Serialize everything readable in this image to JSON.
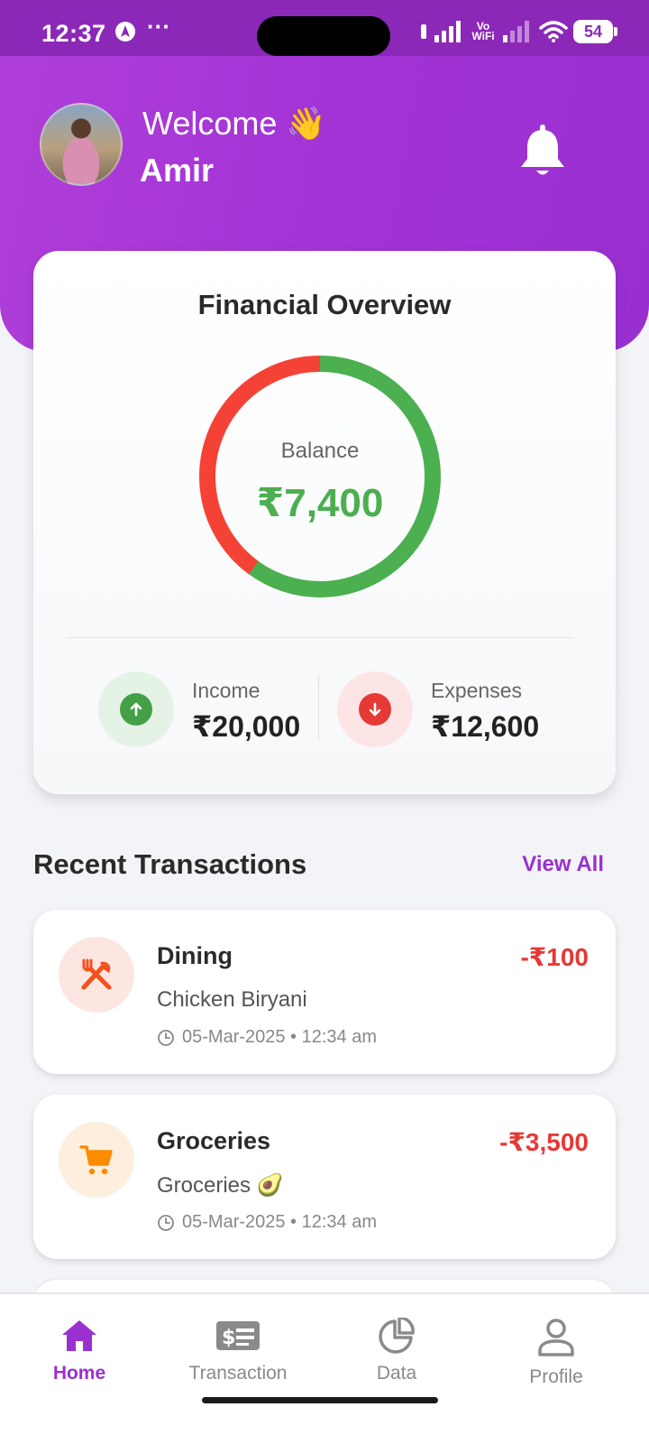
{
  "status_bar": {
    "time": "12:37",
    "more": "···",
    "wifi_label_top": "Vo",
    "wifi_label_bottom": "WiFi",
    "battery": "54"
  },
  "header": {
    "welcome": "Welcome 👋",
    "user_name": "Amir"
  },
  "overview": {
    "title": "Financial Overview",
    "balance_label": "Balance",
    "balance_value": "₹7,400",
    "income_label": "Income",
    "income_value": "₹20,000",
    "expenses_label": "Expenses",
    "expenses_value": "₹12,600",
    "income_fraction": 0.6,
    "expense_fraction": 0.4,
    "colors": {
      "income": "#4caf50",
      "expense": "#f44336"
    }
  },
  "recent": {
    "title": "Recent Transactions",
    "view_all": "View All",
    "transactions": [
      {
        "category": "Dining",
        "description": "Chicken Biryani",
        "timestamp": "05-Mar-2025 • 12:34 am",
        "amount": "-₹100",
        "icon": "fork-knife-icon"
      },
      {
        "category": "Groceries",
        "description": "Groceries 🥑",
        "timestamp": "05-Mar-2025 • 12:34 am",
        "amount": "-₹3,500",
        "icon": "shopping-cart-icon"
      }
    ]
  },
  "nav": {
    "active": "Home",
    "items": [
      {
        "label": "Home",
        "icon": "home-icon"
      },
      {
        "label": "Transaction",
        "icon": "money-list-icon"
      },
      {
        "label": "Data",
        "icon": "pie-chart-icon"
      },
      {
        "label": "Profile",
        "icon": "person-icon"
      }
    ]
  }
}
